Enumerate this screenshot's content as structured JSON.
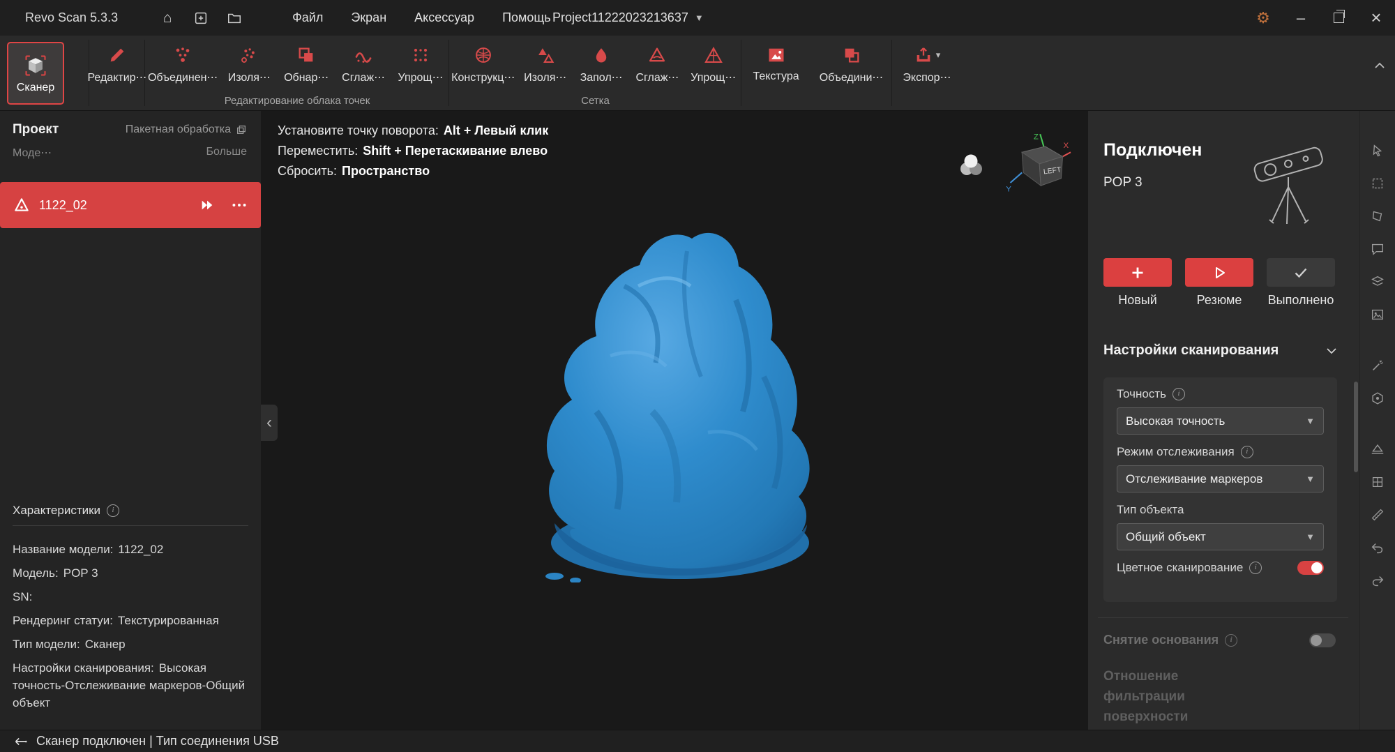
{
  "colors": {
    "accent": "#db4040",
    "model_blue": "#2f8ccd",
    "panel_dark": "#2b2b2b"
  },
  "titlebar": {
    "app_title": "Revo Scan 5.3.3",
    "menus": [
      {
        "label": "Файл"
      },
      {
        "label": "Экран"
      },
      {
        "label": "Аксессуар"
      },
      {
        "label": "Помощь"
      }
    ],
    "project_title": "Project11222023213637",
    "icons": [
      "home-icon",
      "new-project-icon",
      "open-folder-icon",
      "settings-gear-icon",
      "minimize-icon",
      "restore-icon",
      "close-icon"
    ]
  },
  "ribbon": {
    "scanner_label": "Сканер",
    "edit_items": [
      {
        "label": "Редактир⋯",
        "icon": "edit-icon"
      }
    ],
    "point_cloud_group_label": "Редактирование облака точек",
    "point_cloud_items": [
      {
        "label": "Объединен⋯",
        "icon": "merge-points-icon"
      },
      {
        "label": "Изоля⋯",
        "icon": "isolate-points-icon"
      },
      {
        "label": "Обнар⋯",
        "icon": "overlap-detect-icon"
      },
      {
        "label": "Сглаж⋯",
        "icon": "smooth-points-icon"
      },
      {
        "label": "Упрощ⋯",
        "icon": "simplify-points-icon"
      }
    ],
    "mesh_group_label": "Сетка",
    "mesh_items": [
      {
        "label": "Конструкц⋯",
        "icon": "mesh-construct-icon"
      },
      {
        "label": "Изоля⋯",
        "icon": "isolate-mesh-icon"
      },
      {
        "label": "Запол⋯",
        "icon": "fill-holes-icon"
      },
      {
        "label": "Сглаж⋯",
        "icon": "smooth-mesh-icon"
      },
      {
        "label": "Упрощ⋯",
        "icon": "simplify-mesh-icon"
      }
    ],
    "texture_items": [
      {
        "label": "Текстура",
        "icon": "texture-icon"
      },
      {
        "label": "Объедини⋯",
        "icon": "merge-models-icon"
      }
    ],
    "export_items": [
      {
        "label": "Экспор⋯",
        "icon": "export-icon",
        "has_chevron": true
      }
    ]
  },
  "project_panel": {
    "title": "Проект",
    "batch_label": "Пакетная обработка",
    "model_label": "Моде⋯",
    "more_label": "Больше",
    "selected_model": {
      "name": "1122_02"
    },
    "properties_title": "Характеристики",
    "properties": [
      {
        "label": "Название модели:",
        "value": "1122_02"
      },
      {
        "label": "Модель:",
        "value": "POP 3"
      },
      {
        "label": "SN:",
        "value": ""
      },
      {
        "label": "Рендеринг статуи:",
        "value": "Текстурированная"
      },
      {
        "label": "Тип модели:",
        "value": "Сканер"
      },
      {
        "label": "Настройки сканирования:",
        "value": "Высокая точность-Отслеживание маркеров-Общий объект"
      }
    ]
  },
  "viewport": {
    "hints": [
      {
        "action": "Установите точку поворота:",
        "keys": "Alt + Левый клик"
      },
      {
        "action": "Переместить:",
        "keys": "Shift + Перетаскивание влево"
      },
      {
        "action": "Сбросить:",
        "keys": "Пространство"
      }
    ],
    "gizmo_face_label": "LEFT",
    "axis_labels": {
      "z": "Z",
      "x": "X",
      "y": "Y"
    }
  },
  "scan_panel": {
    "status_title": "Подключен",
    "device_name": "POP 3",
    "buttons": [
      {
        "label": "Новый",
        "icon": "plus-icon",
        "variant": "accent"
      },
      {
        "label": "Резюме",
        "icon": "play-icon",
        "variant": "accent"
      },
      {
        "label": "Выполнено",
        "icon": "check-icon",
        "variant": "dark"
      }
    ],
    "settings_title": "Настройки сканирования",
    "fields": [
      {
        "label": "Точность",
        "value": "Высокая точность",
        "info": true
      },
      {
        "label": "Режим отслеживания",
        "value": "Отслеживание маркеров",
        "info": true
      },
      {
        "label": "Тип объекта",
        "value": "Общий объект",
        "info": false
      }
    ],
    "color_scan_label": "Цветное сканирование",
    "color_scan_on": true,
    "remove_base_label": "Снятие основания",
    "remove_base_on": false,
    "surface_filter_label": "Отношение фильтрации поверхности"
  },
  "tool_strip": {
    "icons": [
      {
        "icon": "cursor-select-icon"
      },
      {
        "icon": "rect-select-icon"
      },
      {
        "icon": "polygon-select-icon"
      },
      {
        "icon": "comment-icon"
      },
      {
        "icon": "layers-icon"
      },
      {
        "icon": "texture-view-icon"
      },
      {
        "icon": "magic-wand-icon"
      },
      {
        "icon": "fill-hole-icon"
      },
      {
        "icon": "plane-cut-icon"
      },
      {
        "icon": "grid-icon"
      },
      {
        "icon": "measure-icon"
      },
      {
        "icon": "undo-icon"
      },
      {
        "icon": "redo-icon"
      }
    ]
  },
  "status_bar": {
    "text": "Сканер подключен | Тип соединения USB",
    "icon": "connection-icon"
  }
}
